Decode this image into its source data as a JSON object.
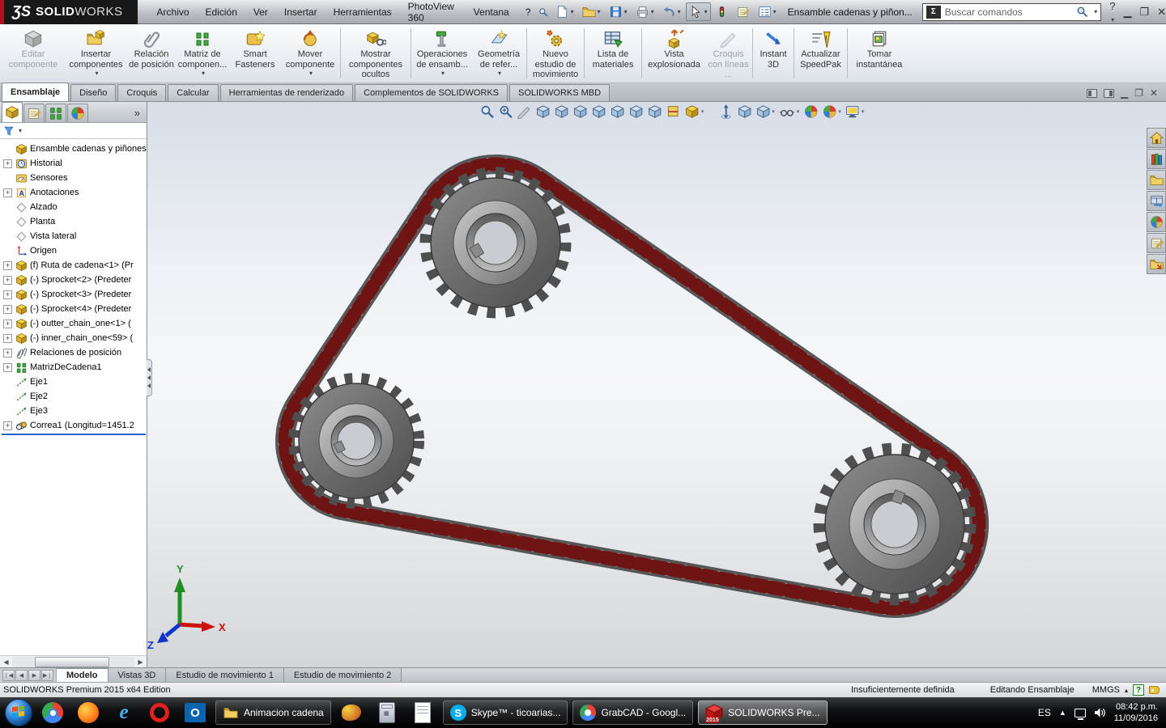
{
  "app": {
    "logo_ds": "ƷS",
    "logo_solid": "SOLID",
    "logo_works": "WORKS",
    "menus": [
      {
        "label": "Archivo"
      },
      {
        "label": "Edición"
      },
      {
        "label": "Ver"
      },
      {
        "label": "Insertar"
      },
      {
        "label": "Herramientas"
      },
      {
        "label": "PhotoView 360"
      },
      {
        "label": "Ventana"
      },
      {
        "label": "?"
      }
    ],
    "doc_title": "Ensamble cadenas y piñon...",
    "search_placeholder": "Buscar comandos",
    "accent_red": "#b40f1e"
  },
  "ribbon": {
    "buttons": [
      {
        "label": "Editar componente",
        "disabled": true
      },
      {
        "label": "Insertar componentes",
        "caret": "▾"
      },
      {
        "label": "Relación de posición"
      },
      {
        "label": "Matriz de componen...",
        "caret": "▾"
      },
      {
        "label": "Smart Fasteners"
      },
      {
        "label": "Mover componente",
        "caret": "▾"
      },
      {
        "label": "Mostrar componentes ocultos"
      },
      {
        "label": "Operaciones de ensamb...",
        "caret": "▾"
      },
      {
        "label": "Geometría de refer...",
        "caret": "▾"
      },
      {
        "label": "Nuevo estudio de movimiento"
      },
      {
        "label": "Lista de materiales"
      },
      {
        "label": "Vista explosionada"
      },
      {
        "label": "Croquis con líneas ...",
        "disabled": true
      },
      {
        "label": "Instant 3D"
      },
      {
        "label": "Actualizar SpeedPak"
      },
      {
        "label": "Tomar instantánea"
      }
    ]
  },
  "command_tabs": [
    {
      "label": "Ensamblaje",
      "active": true
    },
    {
      "label": "Diseño"
    },
    {
      "label": "Croquis"
    },
    {
      "label": "Calcular"
    },
    {
      "label": "Herramientas de renderizado"
    },
    {
      "label": "Complementos de SOLIDWORKS"
    },
    {
      "label": "SOLIDWORKS MBD"
    }
  ],
  "tree": {
    "items": [
      {
        "label": "Ensamble cadenas y piñones"
      },
      {
        "label": "Historial"
      },
      {
        "label": "Sensores"
      },
      {
        "label": "Anotaciones"
      },
      {
        "label": "Alzado"
      },
      {
        "label": "Planta"
      },
      {
        "label": "Vista lateral"
      },
      {
        "label": "Origen"
      },
      {
        "label": "(f) Ruta de cadena<1> (Pr"
      },
      {
        "label": "(-) Sprocket<2> (Predeter"
      },
      {
        "label": "(-) Sprocket<3> (Predeter"
      },
      {
        "label": "(-) Sprocket<4> (Predeter"
      },
      {
        "label": "(-) outter_chain_one<1> ("
      },
      {
        "label": "(-) inner_chain_one<59> ("
      },
      {
        "label": "Relaciones de posición"
      },
      {
        "label": "MatrizDeCadena1"
      },
      {
        "label": "Eje1"
      },
      {
        "label": "Eje2"
      },
      {
        "label": "Eje3"
      },
      {
        "label": "Correa1 (Longitud=1451.2"
      }
    ]
  },
  "viewport": {
    "triad": {
      "x_label": "X",
      "y_label": "Y",
      "z_label": "Z"
    },
    "chain_color": "#6e1414",
    "sprocket_color": "#6e6e6e"
  },
  "doc_tabs": [
    {
      "label": "Modelo",
      "active": true
    },
    {
      "label": "Vistas 3D"
    },
    {
      "label": "Estudio de movimiento 1"
    },
    {
      "label": "Estudio de movimiento 2"
    }
  ],
  "status": {
    "edition": "SOLIDWORKS Premium 2015 x64 Edition",
    "definition": "Insuficientemente definida",
    "mode": "Editando Ensamblaje",
    "units": "MMGS"
  },
  "taskbar": {
    "folder_window": "Animacion cadena",
    "skype_window": "Skype™ - ticoarias...",
    "grabcad_window": "GrabCAD - Googl...",
    "sw_window": "SOLIDWORKS Pre...",
    "sw_badge": "2015",
    "lang": "ES",
    "time": "08:42 p.m.",
    "date": "11/09/2016"
  }
}
